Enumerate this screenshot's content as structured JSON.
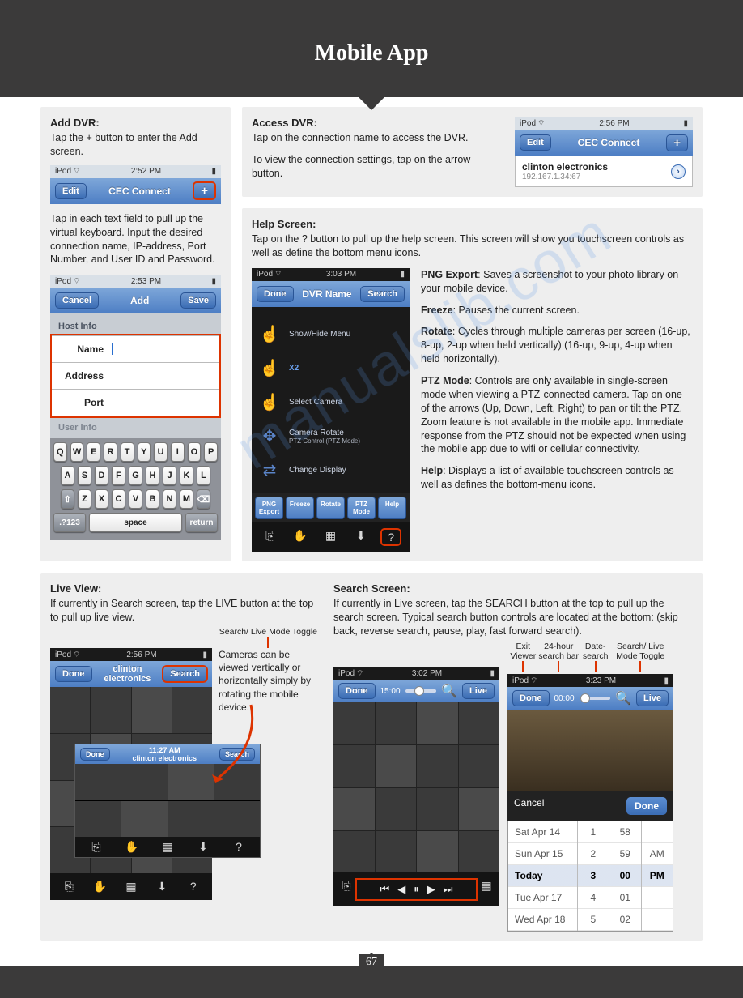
{
  "page_title": "Mobile App",
  "page_number": "67",
  "watermark": "manualslib.com",
  "add_dvr": {
    "heading": "Add DVR:",
    "text": "Tap the + button to enter the Add screen.",
    "status_device": "iPod",
    "status_time": "2:52 PM",
    "nav_left": "Edit",
    "nav_title": "CEC Connect",
    "nav_right": "+",
    "below": "Tap in each text field to pull up the virtual keyboard. Input the desired connection name, IP-address, Port Number, and User ID and Password.",
    "add_status_time": "2:53 PM",
    "add_nav_left": "Cancel",
    "add_nav_title": "Add",
    "add_nav_right": "Save",
    "section_host": "Host Info",
    "field_name": "Name",
    "field_address": "Address",
    "field_port": "Port",
    "section_user": "User Info",
    "kb_r1": [
      "Q",
      "W",
      "E",
      "R",
      "T",
      "Y",
      "U",
      "I",
      "O",
      "P"
    ],
    "kb_r2": [
      "A",
      "S",
      "D",
      "F",
      "G",
      "H",
      "J",
      "K",
      "L"
    ],
    "kb_r3": [
      "Z",
      "X",
      "C",
      "V",
      "B",
      "N",
      "M"
    ],
    "kb_shift": "⇧",
    "kb_del": "⌫",
    "kb_numbers": ".?123",
    "kb_space": "space",
    "kb_return": "return"
  },
  "access_dvr": {
    "heading": "Access DVR:",
    "text1": "Tap on the connection name to access the DVR.",
    "text2": "To view the connection settings, tap on the arrow button.",
    "status_device": "iPod",
    "status_time": "2:56 PM",
    "nav_left": "Edit",
    "nav_title": "CEC Connect",
    "nav_right": "+",
    "conn_name": "clinton electronics",
    "conn_ip": "192.167.1.34:67"
  },
  "help": {
    "heading": "Help Screen:",
    "intro": "Tap on the ? button to pull up the help screen. This screen will show you touchscreen controls as well as define the bottom menu icons.",
    "status_device": "iPod",
    "status_time": "3:03 PM",
    "nav_left": "Done",
    "nav_title": "DVR Name",
    "nav_right": "Search",
    "items": {
      "show_hide": "Show/Hide Menu",
      "x2": "X2",
      "select_camera": "Select Camera",
      "camera_rotate": "Camera Rotate",
      "ptz_control": "PTZ Control (PTZ Mode)",
      "change_display": "Change Display"
    },
    "bb": [
      "PNG Export",
      "Freeze",
      "Rotate",
      "PTZ Mode",
      "Help"
    ],
    "defs": {
      "png_t": "PNG Export",
      "png": ": Saves a screenshot to your photo library on your mobile device.",
      "freeze_t": "Freeze",
      "freeze": ": Pauses the current screen.",
      "rotate_t": "Rotate",
      "rotate": ": Cycles through multiple cameras per screen (16-up, 8-up, 2-up when held vertically) (16-up, 9-up, 4-up when held horizontally).",
      "ptz_t": "PTZ Mode",
      "ptz": ": Controls are only available in single-screen mode when viewing a PTZ-connected camera. Tap on one of the arrows (Up, Down, Left, Right) to pan or tilt the PTZ. Zoom feature is not available in the mobile app. Immediate response from the PTZ should not be expected when using the mobile app due to wifi or cellular connectivity.",
      "help_t": "Help",
      "help": ": Displays a list of available touchscreen controls as well as defines the bottom-menu icons."
    }
  },
  "live": {
    "heading": "Live View:",
    "text": "If currently in Search screen, tap the LIVE button at the top to pull up live view.",
    "callout": "Search/ Live Mode Toggle",
    "status_device": "iPod",
    "status_time": "2:56 PM",
    "nav_left": "Done",
    "nav_title": "clinton electronics",
    "nav_right": "Search",
    "side_text": "Cameras can be viewed vertically or horizontally simply by rotating the mobile device.",
    "inner_time": "11:27 AM",
    "inner_title": "clinton electronics",
    "inner_right": "Search"
  },
  "search": {
    "heading": "Search Screen:",
    "text": "If currently in Live screen, tap the SEARCH button at the top to pull up the search screen. Typical search button controls are located at the bottom: (skip back, reverse search, pause, play, fast forward search).",
    "callouts": [
      "Exit Viewer",
      "24-hour search bar",
      "Date-search",
      "Search/ Live Mode Toggle"
    ],
    "left_time": "3:02 PM",
    "left_nav_left": "Done",
    "left_slider_start": "15:00",
    "left_nav_right": "Live",
    "right_time": "3:23 PM",
    "right_nav_left": "Done",
    "right_slider_start": "00:00",
    "right_nav_right": "Live",
    "picker_cancel": "Cancel",
    "picker_done": "Done",
    "dates": [
      "Sat Apr 14",
      "Sun Apr 15",
      "Today",
      "Tue Apr 17",
      "Wed Apr 18"
    ],
    "hours": [
      "1",
      "2",
      "3",
      "4",
      "5"
    ],
    "mins": [
      "58",
      "59",
      "00",
      "01",
      "02"
    ],
    "ampm": [
      "AM",
      "PM"
    ]
  }
}
